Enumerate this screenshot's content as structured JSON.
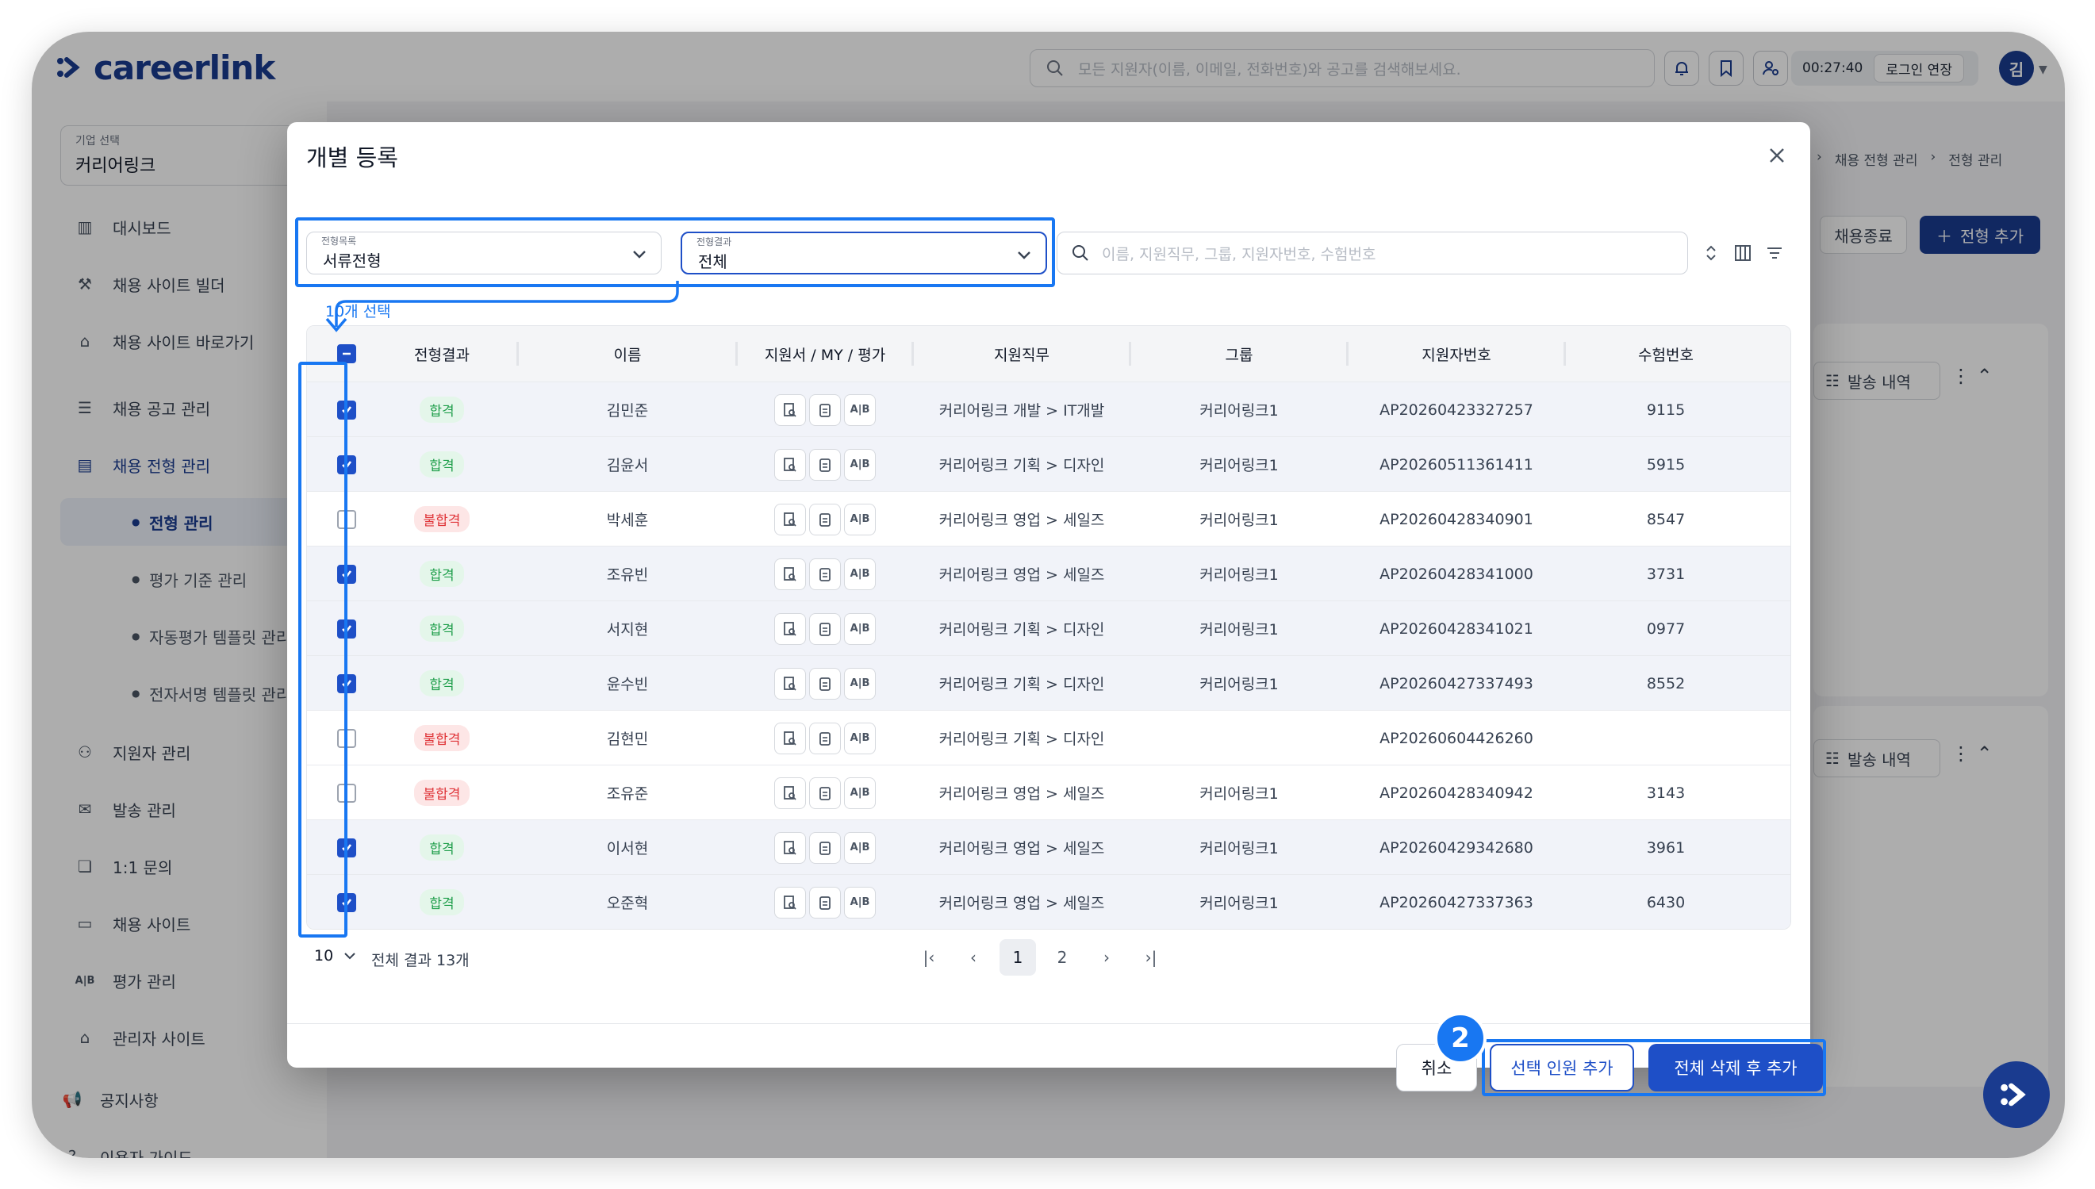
{
  "app": {
    "brand": "careerlink",
    "search_placeholder": "모든 지원자(이름, 이메일, 전화번호)와 공고를 검색해보세요.",
    "timer": "00:27:40",
    "extend_label": "로그인 연장",
    "user_initial": "김"
  },
  "sidebar": {
    "company_label": "기업 선택",
    "company_value": "커리어링크",
    "items": [
      {
        "label": "대시보드"
      },
      {
        "label": "채용 사이트 빌더"
      },
      {
        "label": "채용 사이트 바로가기"
      },
      {
        "label": "채용 공고 관리"
      },
      {
        "label": "채용 전형 관리"
      },
      {
        "label": "지원자 관리"
      },
      {
        "label": "발송 관리"
      },
      {
        "label": "1:1 문의"
      },
      {
        "label": "채용 사이트"
      },
      {
        "label": "평가 관리"
      },
      {
        "label": "관리자 사이트"
      },
      {
        "label": "공지사항"
      },
      {
        "label": "이용자 가이드"
      }
    ],
    "subitems": [
      {
        "label": "전형 관리"
      },
      {
        "label": "평가 기준 관리"
      },
      {
        "label": "자동평가 템플릿 관리"
      },
      {
        "label": "전자서명 템플릿 관리"
      }
    ]
  },
  "background": {
    "breadcrumb_1": "채용 전형 관리",
    "breadcrumb_2": "전형 관리",
    "close_recruit_label": "채용종료",
    "add_stage_label": "전형 추가",
    "send_history_label": "발송 내역"
  },
  "modal": {
    "title": "개별 등록",
    "filter_stage_label": "전형목록",
    "filter_stage_value": "서류전형",
    "filter_result_label": "전형결과",
    "filter_result_value": "전체",
    "search_placeholder": "이름, 지원직무, 그룹, 지원자번호, 수험번호",
    "selected_count": "10개 선택",
    "columns": [
      "전형결과",
      "이름",
      "지원서 / MY / 평가",
      "지원직무",
      "그룹",
      "지원자번호",
      "수험번호"
    ],
    "rows": [
      {
        "checked": true,
        "result": "합격",
        "name": "김민준",
        "job": "커리어링크 개발 > IT개발",
        "group": "커리어링크1",
        "applicant_no": "AP20260423327257",
        "exam_no": "9115"
      },
      {
        "checked": true,
        "result": "합격",
        "name": "김윤서",
        "job": "커리어링크 기획 > 디자인",
        "group": "커리어링크1",
        "applicant_no": "AP20260511361411",
        "exam_no": "5915"
      },
      {
        "checked": false,
        "result": "불합격",
        "name": "박세훈",
        "job": "커리어링크 영업 > 세일즈",
        "group": "커리어링크1",
        "applicant_no": "AP20260428340901",
        "exam_no": "8547"
      },
      {
        "checked": true,
        "result": "합격",
        "name": "조유빈",
        "job": "커리어링크 영업 > 세일즈",
        "group": "커리어링크1",
        "applicant_no": "AP20260428341000",
        "exam_no": "3731"
      },
      {
        "checked": true,
        "result": "합격",
        "name": "서지현",
        "job": "커리어링크 기획 > 디자인",
        "group": "커리어링크1",
        "applicant_no": "AP20260428341021",
        "exam_no": "0977"
      },
      {
        "checked": true,
        "result": "합격",
        "name": "윤수빈",
        "job": "커리어링크 기획 > 디자인",
        "group": "커리어링크1",
        "applicant_no": "AP20260427337493",
        "exam_no": "8552"
      },
      {
        "checked": false,
        "result": "불합격",
        "name": "김현민",
        "job": "커리어링크 기획 > 디자인",
        "group": "",
        "applicant_no": "AP20260604426260",
        "exam_no": ""
      },
      {
        "checked": false,
        "result": "불합격",
        "name": "조유준",
        "job": "커리어링크 영업 > 세일즈",
        "group": "커리어링크1",
        "applicant_no": "AP20260428340942",
        "exam_no": "3143"
      },
      {
        "checked": true,
        "result": "합격",
        "name": "이서현",
        "job": "커리어링크 영업 > 세일즈",
        "group": "커리어링크1",
        "applicant_no": "AP20260429342680",
        "exam_no": "3961"
      },
      {
        "checked": true,
        "result": "합격",
        "name": "오준혁",
        "job": "커리어링크 영업 > 세일즈",
        "group": "커리어링크1",
        "applicant_no": "AP20260427337363",
        "exam_no": "6430"
      }
    ],
    "page_size": "10",
    "total": "전체 결과 13개",
    "pages": [
      "1",
      "2"
    ],
    "current_page": "1",
    "cancel_label": "취소",
    "add_selected_label": "선택 인원 추가",
    "replace_all_label": "전체 삭제 후 추가",
    "step_number": "2",
    "ab_icon_text": "A|B"
  },
  "colors": {
    "brand": "#1a3b8f",
    "primary": "#1e4fc7",
    "highlight": "#1877f2",
    "pass": "#1e9e4a",
    "fail": "#e0363a"
  }
}
